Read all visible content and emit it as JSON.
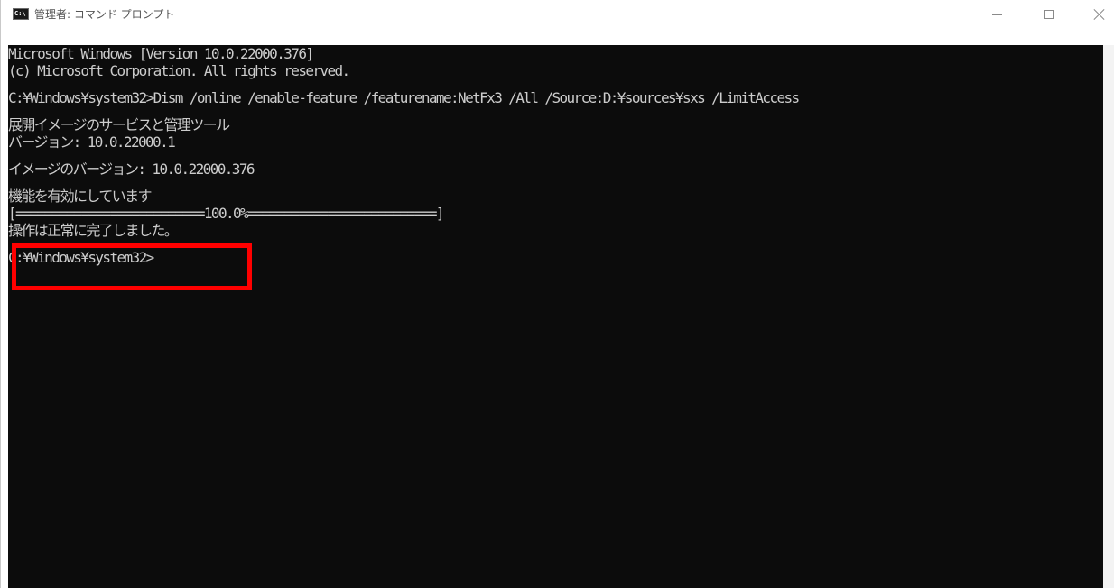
{
  "window": {
    "title": "管理者: コマンド プロンプト",
    "icon": "cmd-icon",
    "icon_text": "C:\\",
    "controls": [
      "minimize-icon",
      "maximize-icon",
      "close-icon"
    ]
  },
  "console": {
    "lines": [
      "Microsoft Windows [Version 10.0.22000.376]",
      "(c) Microsoft Corporation. All rights reserved.",
      "",
      "C:¥Windows¥system32>Dism /online /enable-feature /featurename:NetFx3 /All /Source:D:¥sources¥sxs /LimitAccess",
      "",
      "展開イメージのサービスと管理ツール",
      "バージョン: 10.0.22000.1",
      "",
      "イメージのバージョン: 10.0.22000.376",
      "",
      "機能を有効にしています",
      "[==========================100.0%==========================]",
      "操作は正常に完了しました。",
      "",
      "C:¥Windows¥system32>"
    ]
  },
  "colors": {
    "console_bg": "#0c0c0c",
    "console_text": "#cccccc",
    "highlight": "#ff0000"
  }
}
